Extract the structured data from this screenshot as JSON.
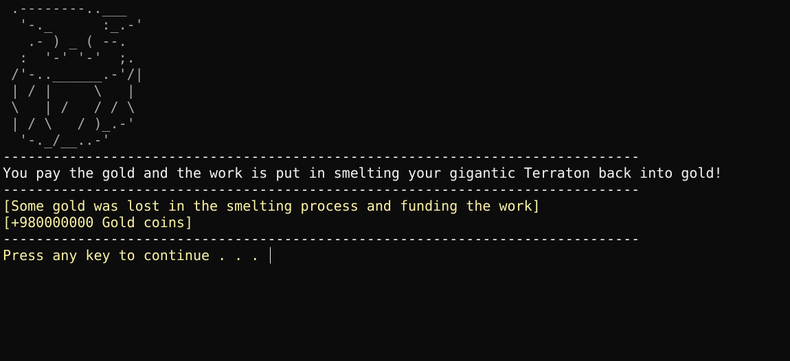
{
  "ascii_art": [
    " .--------..___",
    "  '-._      :_.-'",
    "   .- ) _ ( --.",
    "  :  '-' '-'  ;.",
    " /'-..______.-'/|",
    " | / |     \\   |",
    " \\   | /   / / \\",
    " | / \\   / )_.-'",
    "  '-._/__..-'"
  ],
  "separator": "-----------------------------------------------------------------------------",
  "message": "You pay the gold and the work is put in smelting your gigantic Terraton back into gold!",
  "notes": [
    "[Some gold was lost in the smelting process and funding the work]",
    "[+980000000 Gold coins]"
  ],
  "prompt": "Press any key to continue . . . "
}
